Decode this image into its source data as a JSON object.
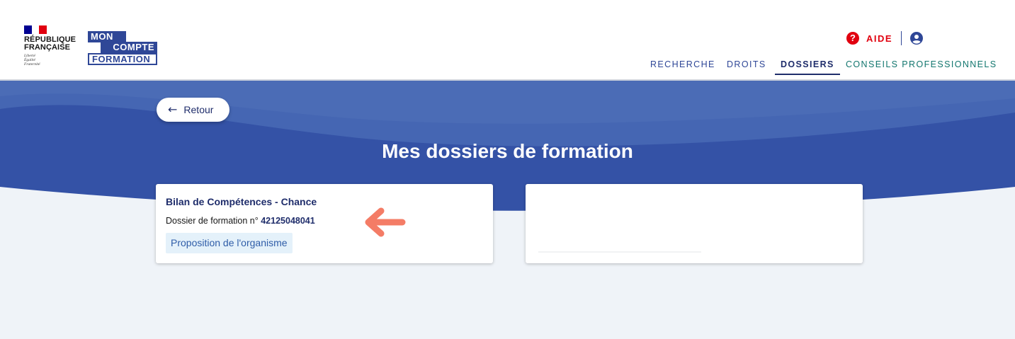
{
  "header": {
    "republic": {
      "line1": "RÉPUBLIQUE",
      "line2": "FRANÇAISE",
      "motto": [
        "Liberté",
        "Égalité",
        "Fraternité"
      ]
    },
    "brand": {
      "line1": "MON",
      "line2": "COMPTE",
      "line3": "FORMATION"
    },
    "help_label": "AIDE",
    "help_icon": "question-circle-icon",
    "user_icon": "user-circle-icon",
    "nav": [
      {
        "label": "RECHERCHE",
        "active": false
      },
      {
        "label": "DROITS",
        "active": false
      },
      {
        "label": "DOSSIERS",
        "active": true
      },
      {
        "label": "CONSEILS PROFESSIONNELS",
        "active": false
      }
    ]
  },
  "back_button": {
    "label": "Retour",
    "icon": "arrow-left-icon"
  },
  "page_title": "Mes dossiers de formation",
  "cards": [
    {
      "title": "Bilan de Compétences - Chance",
      "dossier_prefix": "Dossier de formation n°",
      "dossier_number": "42125048041",
      "status": "Proposition de l'organisme"
    }
  ],
  "colors": {
    "brand_blue": "#2f4797",
    "dark_blue": "#1f2d6b",
    "banner_blue": "#3452a6",
    "help_red": "#e1000f",
    "nav_green": "#12766e",
    "pointer_arrow": "#f47c66",
    "page_background": "#eff3f8"
  }
}
